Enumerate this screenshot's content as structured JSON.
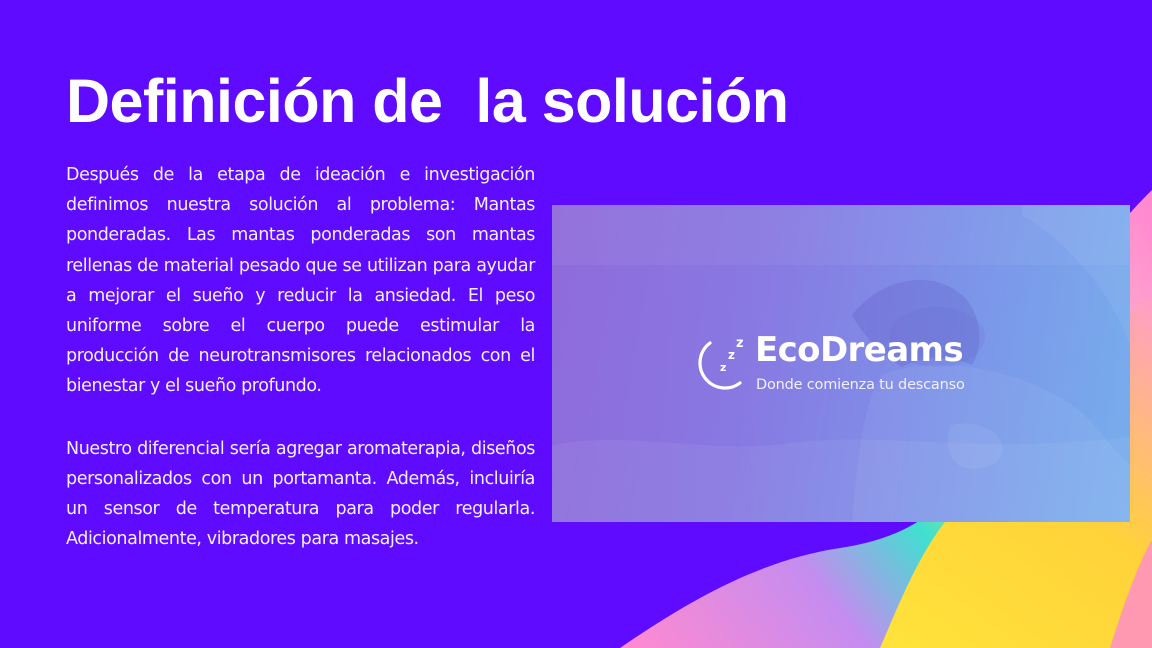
{
  "slide": {
    "title": "Definición de  la solución",
    "paragraphs": [
      "Después de la etapa de ideación e investigación definimos nuestra solución al problema: Mantas ponderadas. Las mantas ponderadas son mantas rellenas de material pesado que se utilizan para ayudar a mejorar el sueño y reducir la ansiedad. El peso uniforme sobre el cuerpo puede estimular la producción de neurotransmisores relacionados con el bienestar y el sueño profundo.",
      "Nuestro diferencial sería agregar aromaterapia, diseños personalizados con un portamanta. Además, incluiría un sensor de temperatura para poder regularla. Adicionalmente, vibradores para masajes."
    ]
  },
  "brand": {
    "name": "EcoDreams",
    "tagline": "Donde comienza tu descanso",
    "logo_icon": "moon-zzz-icon",
    "logo_lettering": "z z z"
  },
  "colors": {
    "background": "#5e0bff",
    "text": "#ffffff",
    "card_gradient_start": "#8a63d8",
    "card_gradient_end": "#64a3ea",
    "blob_pink": "#ff8ad0",
    "blob_yellow": "#ffe23a",
    "blob_teal": "#3fe0d0"
  }
}
